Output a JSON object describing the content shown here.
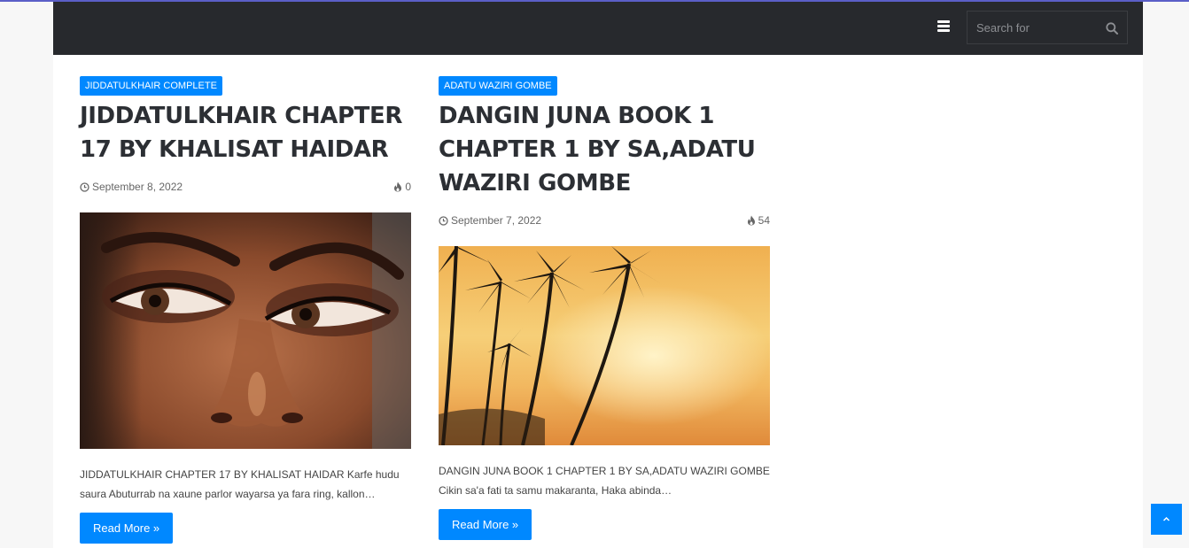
{
  "header": {
    "menu_icon": "hamburger-menu-icon",
    "search": {
      "placeholder": "Search for",
      "icon": "search-icon"
    }
  },
  "posts": [
    {
      "category": "JIDDATULKHAIR COMPLETE",
      "title": "JIDDATULKHAIR CHAPTER 17 BY KHALISAT HAIDAR",
      "date": "September 8, 2022",
      "views": "0",
      "image": "close-up-face-eyes",
      "excerpt": "JIDDATULKHAIR CHAPTER 17 BY KHALISAT HAIDAR     Karfe hudu saura Abuturrab na xaune parlor wayarsa ya fara ring, kallon…",
      "read_more": "Read More »"
    },
    {
      "category": "ADATU WAZIRI GOMBE",
      "title": "DANGIN JUNA BOOK 1 CHAPTER 1 BY SA,ADATU WAZIRI GOMBE",
      "date": "September 7, 2022",
      "views": "54",
      "image": "palm-trees-sunset",
      "excerpt": "DANGIN JUNA BOOK 1 CHAPTER 1 BY SA,ADATU WAZIRI GOMBE     Cikin sa'a fati ta samu makaranta, Haka abinda…",
      "read_more": "Read More »"
    }
  ],
  "back_to_top_icon": "chevron-up-icon",
  "colors": {
    "accent": "#0088ff",
    "header_bg": "#27292d",
    "top_line": "#5b5fc7"
  }
}
